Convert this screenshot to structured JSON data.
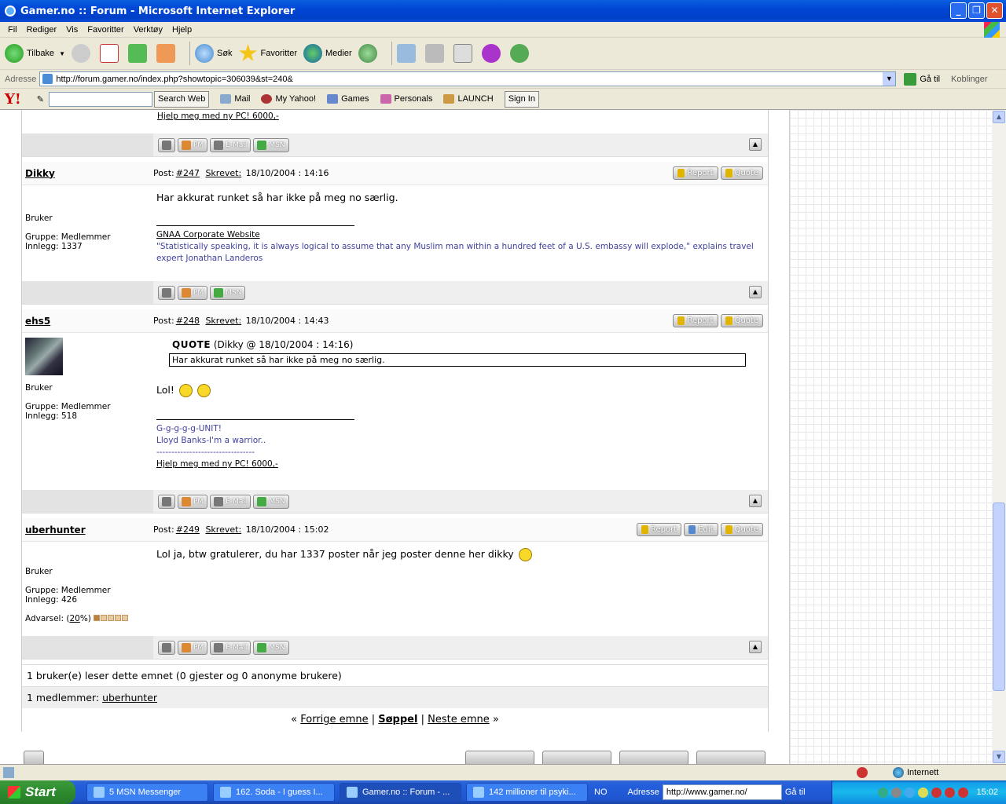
{
  "window": {
    "title": "Gamer.no :: Forum - Microsoft Internet Explorer",
    "minimize": "_",
    "maximize": "❐",
    "close": "✕"
  },
  "menu": [
    "Fil",
    "Rediger",
    "Vis",
    "Favoritter",
    "Verktøy",
    "Hjelp"
  ],
  "toolbar": {
    "back": "Tilbake",
    "search": "Søk",
    "favorites": "Favoritter",
    "media": "Medier"
  },
  "address": {
    "label": "Adresse",
    "url": "http://forum.gamer.no/index.php?showtopic=306039&st=240&",
    "go": "Gå til",
    "links": "Koblinger"
  },
  "yahoo": {
    "logo": "Y!",
    "search_button": "Search Web",
    "mail": "Mail",
    "my_yahoo": "My Yahoo!",
    "games": "Games",
    "personals": "Personals",
    "launch": "LAUNCH",
    "sign_in": "Sign In"
  },
  "prev_post": {
    "sig_link": "Hjelp meg med ny PC! 6000,-",
    "buttons": [
      "PM",
      "E-Mail",
      "MSN"
    ]
  },
  "posts": [
    {
      "user": "Dikky",
      "post_label": "Post:",
      "post_no": "#247",
      "written_label": "Skrevet:",
      "date": "18/10/2004 : 14:16",
      "rank": "Bruker",
      "group": "Gruppe: Medlemmer",
      "count": "Innlegg: 1337",
      "text": "Har akkurat runket så har ikke på meg no særlig.",
      "sig_link": "GNAA Corporate Website",
      "sig_text": "\"Statistically speaking, it is always logical to assume that any Muslim man within a hundred feet of a U.S. embassy will explode,\" explains travel expert Jonathan Landeros",
      "buttons": [
        "Report",
        "Quote"
      ],
      "bottom_buttons": [
        "PM",
        "MSN"
      ]
    },
    {
      "user": "ehs5",
      "post_label": "Post:",
      "post_no": "#248",
      "written_label": "Skrevet:",
      "date": "18/10/2004 : 14:43",
      "rank": "Bruker",
      "group": "Gruppe: Medlemmer",
      "count": "Innlegg: 518",
      "quote_label": "QUOTE",
      "quote_src": " (Dikky @ 18/10/2004 : 14:16)",
      "quote_text": "Har akkurat runket så har ikke på meg no særlig.",
      "text": "Lol!",
      "sig_line1": "G-g-g-g-g-UNIT!",
      "sig_line2": "Lloyd Banks-I'm a warrior..",
      "sig_line3": "---------------------------------",
      "sig_link": "Hjelp meg med ny PC! 6000,-",
      "buttons": [
        "Report",
        "Quote"
      ],
      "bottom_buttons": [
        "PM",
        "E-Mail",
        "MSN"
      ]
    },
    {
      "user": "uberhunter",
      "post_label": "Post:",
      "post_no": "#249",
      "written_label": "Skrevet:",
      "date": "18/10/2004 : 15:02",
      "rank": "Bruker",
      "group": "Gruppe: Medlemmer",
      "count": "Innlegg: 426",
      "warn_label": "Advarsel: (",
      "warn_pct": "20",
      "warn_end": "%)",
      "warn_level": 0.2,
      "text": "Lol ja, btw gratulerer, du har 1337 poster når jeg poster denne her dikky",
      "buttons": [
        "Report",
        "Edit",
        "Quote"
      ],
      "bottom_buttons": [
        "PM",
        "E-Mail",
        "MSN"
      ]
    }
  ],
  "footer": {
    "readers": "1 bruker(e) leser dette emnet (0 gjester og 0 anonyme brukere)",
    "members_label": "1 medlemmer:",
    "members_user": "uberhunter",
    "nav_prev": "Forrige emne",
    "nav_trash": "Søppel",
    "nav_next": "Neste emne",
    "open_quote": "«",
    "close_quote": "»",
    "sep": "|"
  },
  "status": {
    "zone": "Internett"
  },
  "taskbar": {
    "start": "Start",
    "tasks": [
      "5 MSN Messenger",
      "162. Soda - I guess I...",
      "Gamer.no :: Forum - ...",
      "142 millioner til psyki..."
    ],
    "lang": "NO",
    "address_label": "Adresse",
    "address_value": "http://www.gamer.no/",
    "go": "Gå til",
    "clock": "15:02"
  }
}
